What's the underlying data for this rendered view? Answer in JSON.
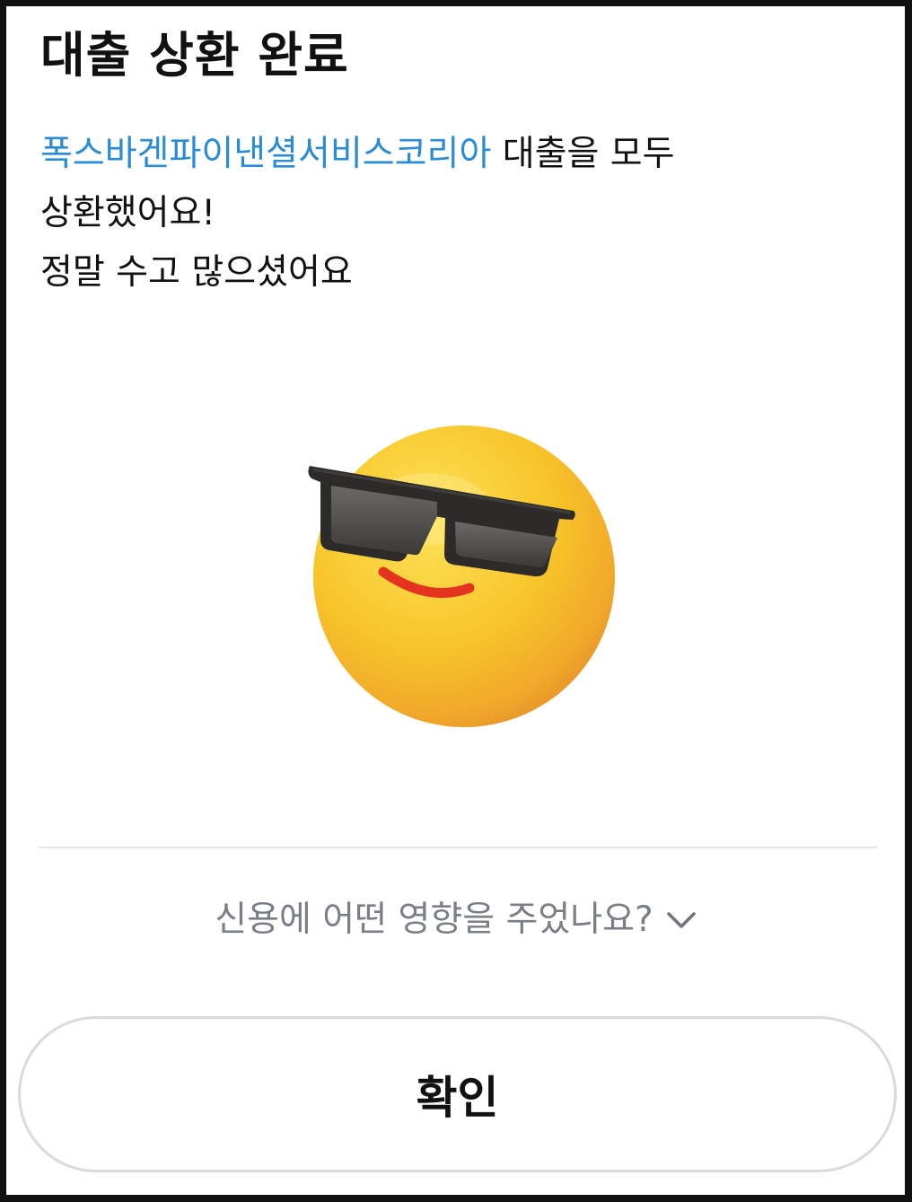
{
  "header": {
    "title": "대출 상환 완료"
  },
  "message": {
    "lender": "폭스바겐파이낸셜서비스코리아",
    "line1_rest": " 대출을 모두",
    "line2": "상환했어요!",
    "line3": "정말 수고 많으셨어요"
  },
  "illustration": {
    "icon": "sunglasses-smiley-emoji-icon"
  },
  "credit_impact": {
    "label": "신용에 어떤 영향을 주었나요?",
    "icon": "chevron-down-icon"
  },
  "footer": {
    "confirm_label": "확인"
  },
  "colors": {
    "accent": "#2a8bd6",
    "muted_text": "#7a7f86",
    "divider": "#e8e9eb",
    "button_border": "#d8dbdf",
    "emoji_yellow": "#f6c42a",
    "smile_red": "#e4331f"
  }
}
